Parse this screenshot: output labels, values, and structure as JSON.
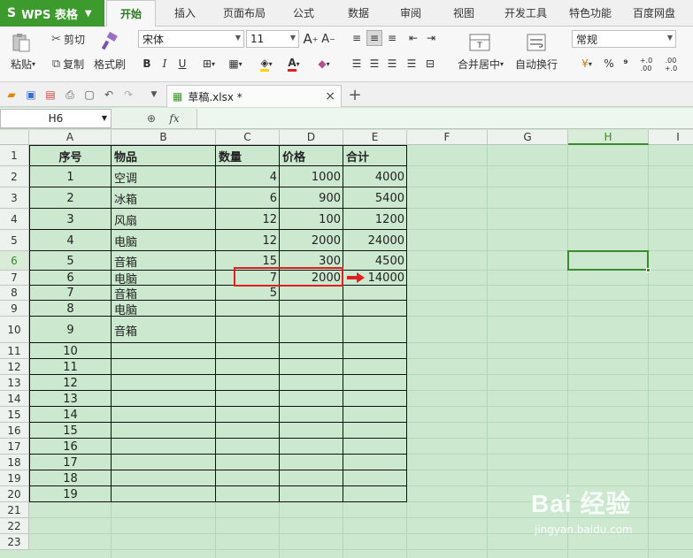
{
  "app": {
    "name": "WPS 表格"
  },
  "menu_tabs": [
    "开始",
    "插入",
    "页面布局",
    "公式",
    "数据",
    "审阅",
    "视图",
    "开发工具",
    "特色功能",
    "百度网盘"
  ],
  "active_tab": "开始",
  "ribbon": {
    "paste": "粘贴",
    "cut": "剪切",
    "copy": "复制",
    "format_painter": "格式刷",
    "font_name": "宋体",
    "font_size": "11",
    "bold": "B",
    "italic": "I",
    "underline": "U",
    "merge_center": "合并居中",
    "wrap_text": "自动换行",
    "number_format": "常规",
    "percent": "%",
    "comma": "⁹",
    "inc_decimal": "+.0\n.00",
    "dec_decimal": ".00\n+.0"
  },
  "document": {
    "tab_name": "草稿.xlsx *",
    "close": "×",
    "new_tab": "+"
  },
  "formula_bar": {
    "name_box": "H6",
    "fx": "fx",
    "zoom_icon": "🔍"
  },
  "columns": [
    "A",
    "B",
    "C",
    "D",
    "E",
    "F",
    "G",
    "H",
    "I"
  ],
  "selected_cell": "H6",
  "rows": [
    "1",
    "2",
    "3",
    "4",
    "5",
    "6",
    "7",
    "8",
    "9",
    "10",
    "11",
    "12",
    "13",
    "14",
    "15",
    "16",
    "17",
    "18",
    "19",
    "20",
    "21",
    "22",
    "23"
  ],
  "table": {
    "headers": [
      "序号",
      "物品",
      "数量",
      "价格",
      "合计"
    ],
    "data": [
      [
        "1",
        "空调",
        "4",
        "1000",
        "4000"
      ],
      [
        "2",
        "冰箱",
        "6",
        "900",
        "5400"
      ],
      [
        "3",
        "风扇",
        "12",
        "100",
        "1200"
      ],
      [
        "4",
        "电脑",
        "12",
        "2000",
        "24000"
      ],
      [
        "5",
        "音箱",
        "15",
        "300",
        "4500"
      ],
      [
        "6",
        "电脑",
        "7",
        "2000",
        "14000"
      ],
      [
        "7",
        "音箱",
        "5",
        "",
        ""
      ],
      [
        "8",
        "电脑",
        "",
        "",
        ""
      ],
      [
        "9",
        "音箱",
        "",
        "",
        ""
      ],
      [
        "10",
        "",
        "",
        "",
        ""
      ],
      [
        "11",
        "",
        "",
        "",
        ""
      ],
      [
        "12",
        "",
        "",
        "",
        ""
      ],
      [
        "13",
        "",
        "",
        "",
        ""
      ],
      [
        "14",
        "",
        "",
        "",
        ""
      ],
      [
        "15",
        "",
        "",
        "",
        ""
      ],
      [
        "16",
        "",
        "",
        "",
        ""
      ],
      [
        "17",
        "",
        "",
        "",
        ""
      ],
      [
        "18",
        "",
        "",
        "",
        ""
      ],
      [
        "19",
        "",
        "",
        "",
        ""
      ]
    ]
  },
  "watermark": {
    "brand": "Bai 经验",
    "url": "jingyan.baidu.com"
  },
  "colors": {
    "accent": "#3d9a2c",
    "sheet_bg": "#cce8cf",
    "highlight": "#e02020"
  }
}
